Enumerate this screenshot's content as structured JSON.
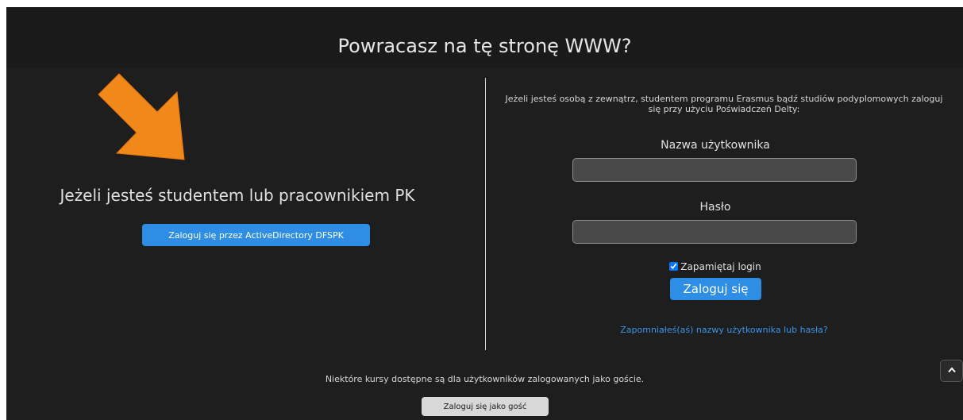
{
  "header": {
    "title": "Powracasz na tę stronę WWW?"
  },
  "left_panel": {
    "title": "Jeżeli jesteś studentem lub pracownikiem PK",
    "ad_login_button": "Zaloguj się przez ActiveDirectory DFSPK",
    "arrow_color": "#f0881a"
  },
  "right_panel": {
    "info_text": "Jeżeli jesteś osobą z zewnątrz, studentem programu Erasmus bądź studiów podyplomowych zaloguj się przy użyciu Poświadczeń Delty:",
    "username_label": "Nazwa użytkownika",
    "username_value": "",
    "password_label": "Hasło",
    "password_value": "",
    "remember_label": "Zapamiętaj login",
    "remember_checked": true,
    "login_button": "Zaloguj się",
    "forgot_link": "Zapomniałeś(aś) nazwy użytkownika lub hasła?"
  },
  "footer": {
    "guest_info": "Niektóre kursy dostępne są dla użytkowników zalogowanych jako goście.",
    "guest_button": "Zaloguj się jako gość"
  },
  "icons": {
    "scroll_top": "chevron-up-icon",
    "arrow": "arrow-down-right-icon"
  },
  "colors": {
    "background": "#1e1e1e",
    "accent": "#2e8ee6",
    "link": "#3c95e8"
  }
}
